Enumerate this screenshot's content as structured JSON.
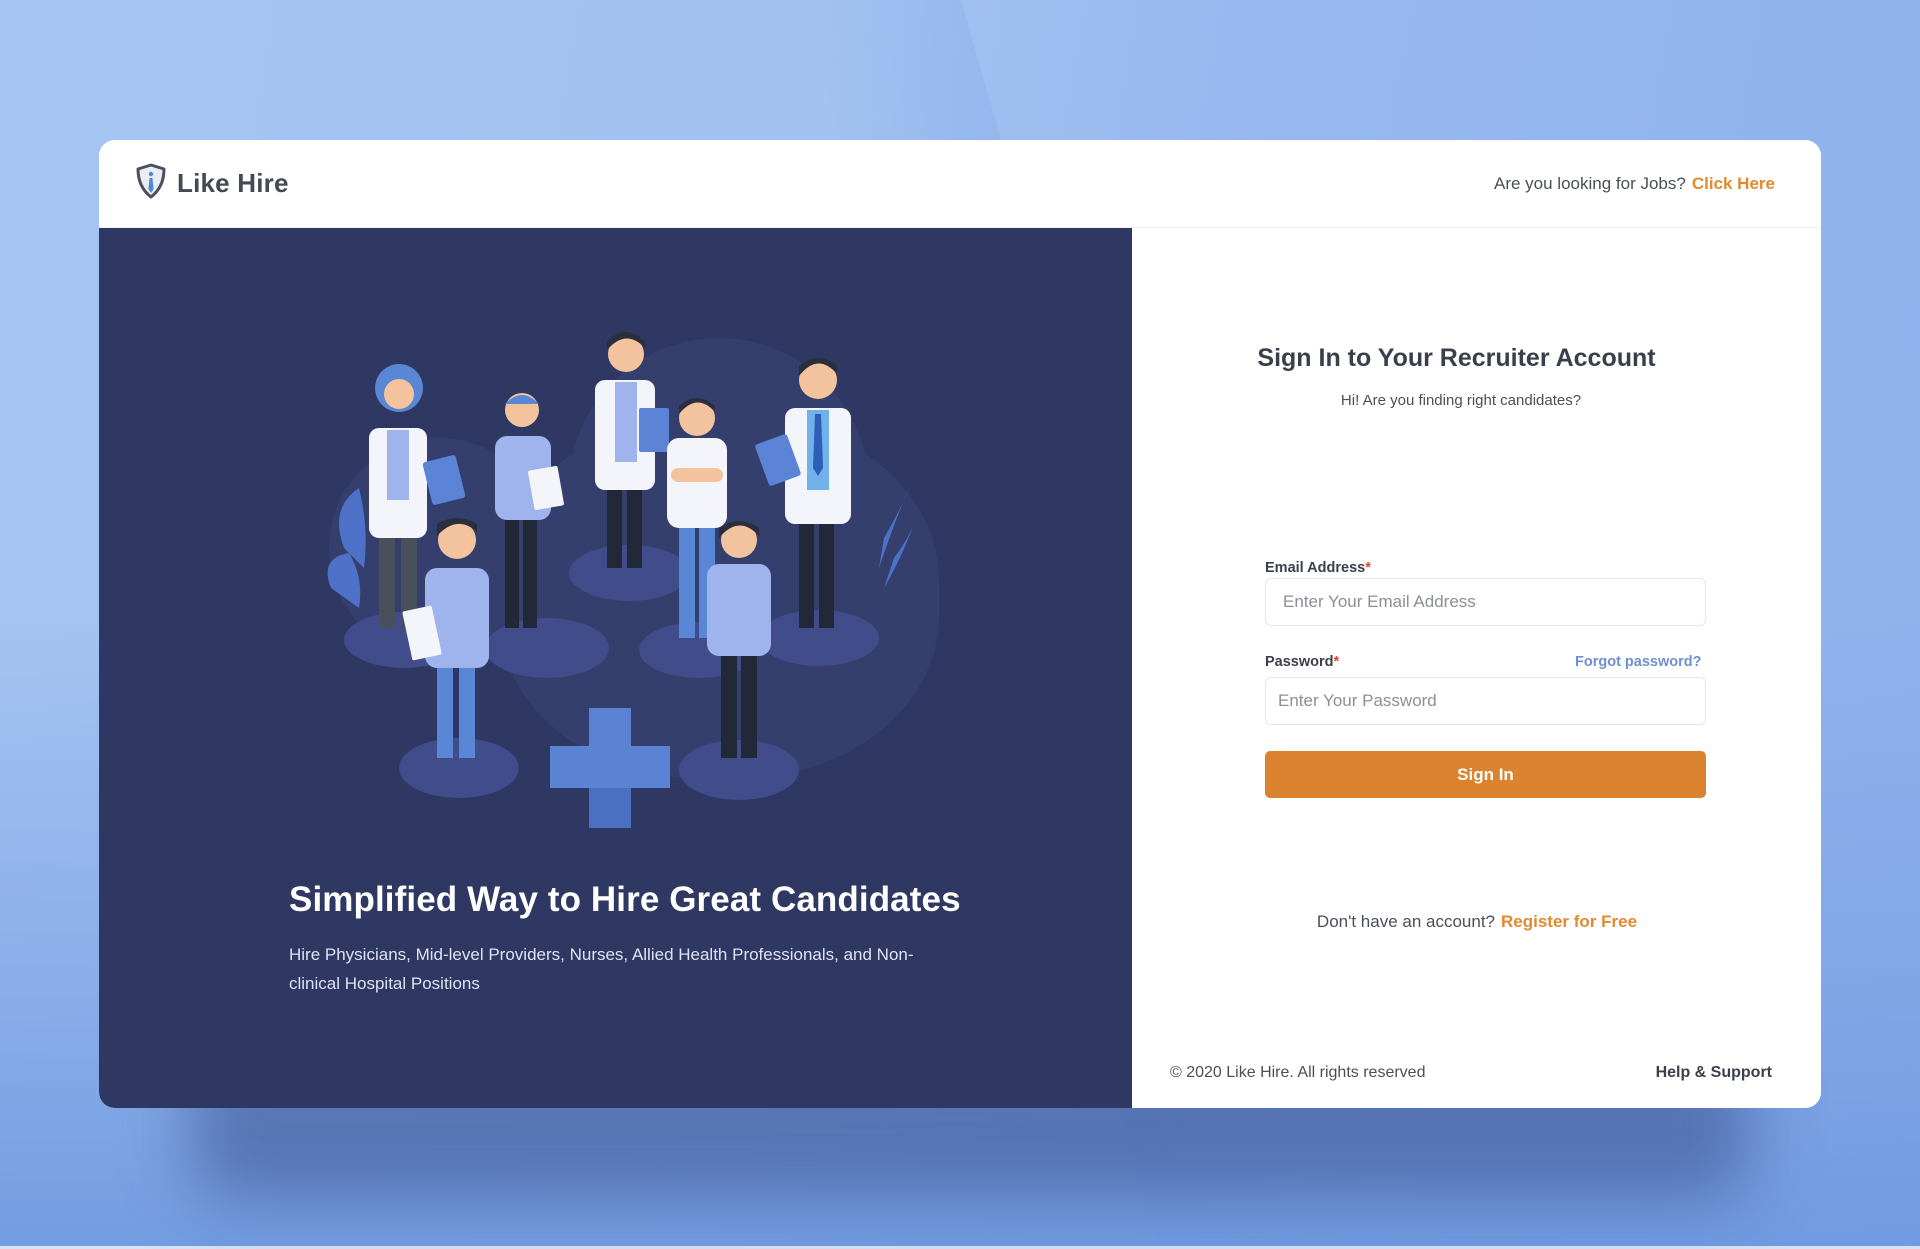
{
  "header": {
    "brand_name": "Like Hire",
    "brand_icon": "shield-tie-icon",
    "jobs_prompt": "Are you looking for Jobs?",
    "jobs_link": "Click Here"
  },
  "hero": {
    "illustration": "medical-team-illustration",
    "headline": "Simplified Way to Hire Great Candidates",
    "subtext": "Hire Physicians, Mid-level Providers, Nurses, Allied Health Professionals, and Non-clinical Hospital Positions"
  },
  "form": {
    "title": "Sign In to Your Recruiter Account",
    "subtitle": "Hi! Are you finding right candidates?",
    "email": {
      "label": "Email Address",
      "required_mark": "*",
      "placeholder": "Enter Your Email Address",
      "value": ""
    },
    "password": {
      "label": "Password",
      "required_mark": "*",
      "placeholder": "Enter Your Password",
      "value": ""
    },
    "forgot_password": "Forgot password?",
    "submit_label": "Sign In",
    "register_prompt": "Don't have an account?",
    "register_link": "Register for Free"
  },
  "footer": {
    "copyright": "© 2020 Like Hire. All rights reserved",
    "help_link": "Help & Support"
  },
  "colors": {
    "accent_orange": "#db832f",
    "link_blue": "#6f8fcf",
    "panel_navy": "#2f3763",
    "required_red": "#e0403c"
  }
}
